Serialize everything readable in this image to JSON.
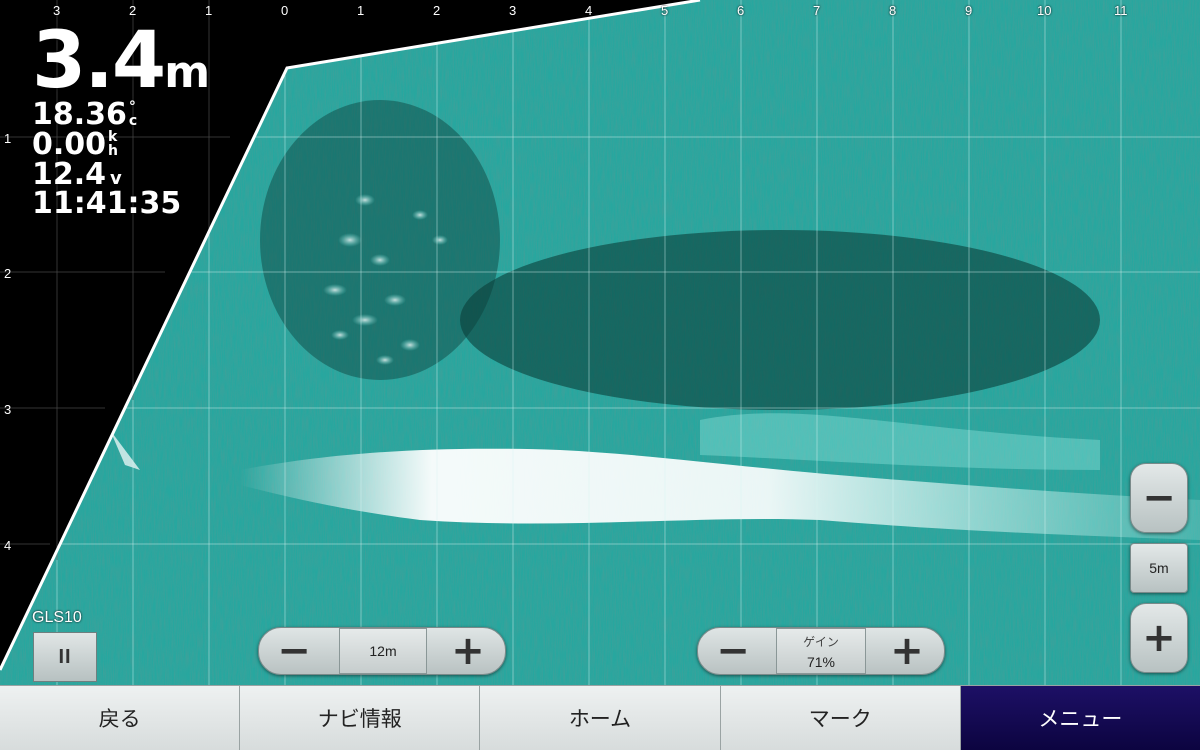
{
  "readouts": {
    "depth_value": "3.4",
    "depth_unit": "m",
    "temperature_value": "18.36",
    "temperature_unit_top": "°",
    "temperature_unit_bottom": "c",
    "speed_value": "0.00",
    "speed_unit_top": "k",
    "speed_unit_bottom": "h",
    "voltage_value": "12.4",
    "voltage_unit": "v",
    "time": "11:41:35"
  },
  "axes": {
    "top_labels": [
      "3",
      "2",
      "1",
      "0",
      "1",
      "2",
      "3",
      "4",
      "5",
      "6",
      "7",
      "8",
      "9",
      "10",
      "11"
    ],
    "left_labels": [
      "1",
      "2",
      "3",
      "4"
    ]
  },
  "range_control": {
    "minus": "−",
    "value": "12m",
    "plus": "+"
  },
  "gain_control": {
    "minus": "−",
    "label": "ゲイン",
    "value": "71%",
    "plus": "+"
  },
  "zoom_control": {
    "minus": "−",
    "value": "5m",
    "plus": "+"
  },
  "source": {
    "label": "GLS10",
    "pause_symbol": "II"
  },
  "bottom_nav": {
    "back": "戻る",
    "navi_info": "ナビ情報",
    "home": "ホーム",
    "mark": "マーク",
    "menu": "メニュー"
  },
  "colors": {
    "sonar_bright": "#ffffff",
    "sonar_mid": "#2fbfb4",
    "sonar_dark": "#0a3b36",
    "active_tab": "#140a55"
  }
}
